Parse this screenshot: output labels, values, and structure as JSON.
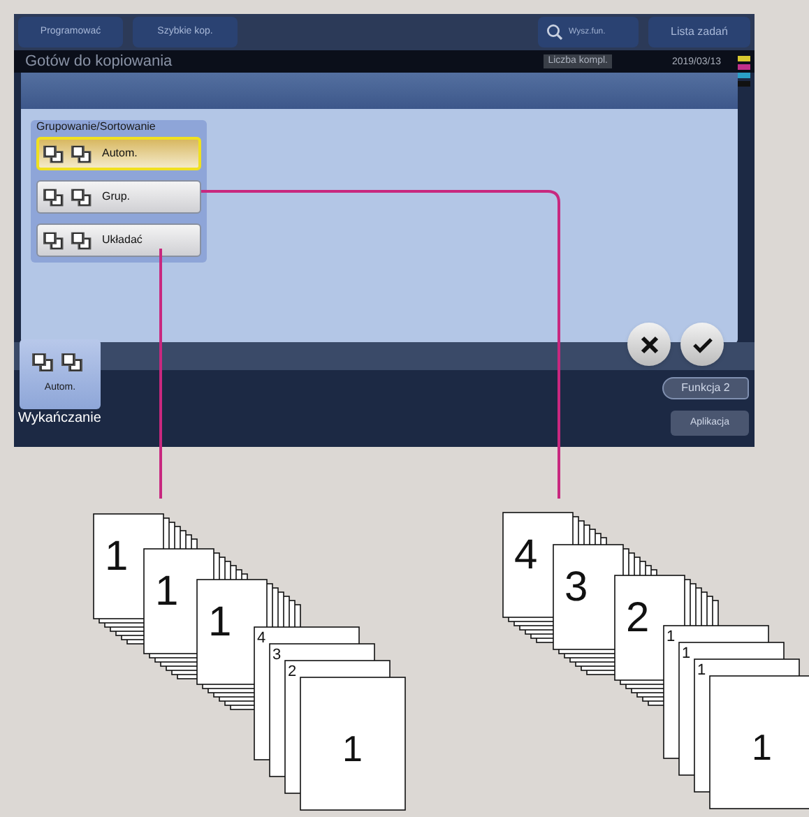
{
  "top_buttons": [
    {
      "label": "Programować"
    },
    {
      "label": "Szybkie kop."
    }
  ],
  "search": {
    "placeholder": "Wysz.fun."
  },
  "job_list_button": {
    "label": "Lista zadań"
  },
  "status": {
    "title": "Gotów do kopiowania",
    "copies_label": "Liczba kompl.",
    "date": "2019/03/13"
  },
  "dialog": {
    "group_title": "Grupowanie/Sortowanie",
    "options": [
      {
        "label": "Autom.",
        "selected": true
      },
      {
        "label": "Grup.",
        "selected": false
      },
      {
        "label": "Układać",
        "selected": false
      }
    ]
  },
  "finishing_tab": {
    "label": "Autom.",
    "caption": "Wykańczanie"
  },
  "side_buttons": [
    {
      "label": "Funkcja 2",
      "kind": "arrow"
    },
    {
      "label": "Aplikacja",
      "kind": "plain"
    }
  ],
  "illustrations": [
    {
      "groups": [
        {
          "kind": "stack",
          "sheets": [
            "1"
          ]
        },
        {
          "kind": "stack",
          "sheets": [
            "1"
          ]
        },
        {
          "kind": "stack",
          "sheets": [
            "1"
          ]
        },
        {
          "kind": "fan",
          "sheets": [
            "4",
            "3",
            "2",
            "1"
          ]
        }
      ]
    },
    {
      "groups": [
        {
          "kind": "stack",
          "sheets": [
            "4"
          ]
        },
        {
          "kind": "stack",
          "sheets": [
            "3"
          ]
        },
        {
          "kind": "stack",
          "sheets": [
            "2"
          ]
        },
        {
          "kind": "fan",
          "sheets": [
            "1",
            "1",
            "1",
            "1"
          ]
        }
      ]
    }
  ]
}
